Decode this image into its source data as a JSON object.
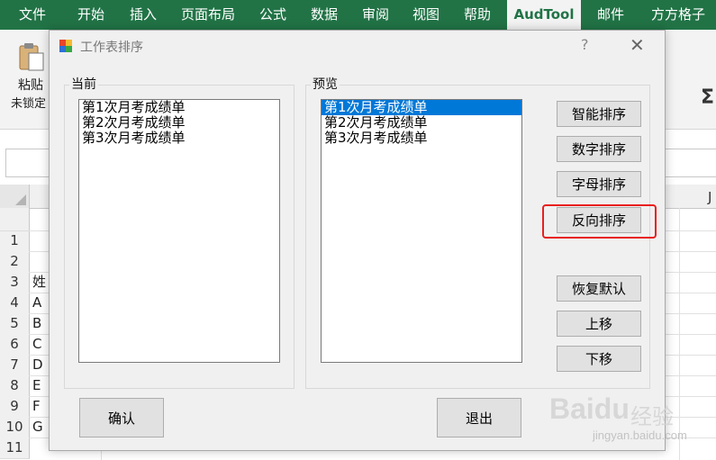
{
  "ribbon": {
    "tabs": [
      "文件",
      "开始",
      "插入",
      "页面布局",
      "公式",
      "数据",
      "审阅",
      "视图",
      "帮助",
      "AudTool",
      "邮件",
      "方方格子"
    ],
    "active_tab": "AudTool",
    "paste_label": "粘贴",
    "unlock_label": "未锁定",
    "sigma": "Σ"
  },
  "grid": {
    "column_j": "J",
    "rows": [
      "1",
      "2",
      "3",
      "4",
      "5",
      "6",
      "7",
      "8",
      "9",
      "10",
      "11"
    ],
    "col_a": [
      "",
      "",
      "姓",
      "A",
      "B",
      "C",
      "D",
      "E",
      "F",
      "G",
      ""
    ]
  },
  "dialog": {
    "title": "工作表排序",
    "help": "?",
    "close": "✕",
    "current": {
      "label": "当前",
      "items": [
        "第1次月考成绩单",
        "第2次月考成绩单",
        "第3次月考成绩单"
      ]
    },
    "preview": {
      "label": "预览",
      "items": [
        "第1次月考成绩单",
        "第2次月考成绩单",
        "第3次月考成绩单"
      ],
      "selected_index": 0
    },
    "buttons": {
      "smart_sort": "智能排序",
      "number_sort": "数字排序",
      "alpha_sort": "字母排序",
      "reverse_sort": "反向排序",
      "restore_default": "恢复默认",
      "move_up": "上移",
      "move_down": "下移",
      "confirm": "确认",
      "exit": "退出"
    },
    "highlight_color": "#e8201e"
  },
  "watermark": {
    "brand": "Baidu",
    "cn": "经验",
    "url": "jingyan.baidu.com"
  }
}
